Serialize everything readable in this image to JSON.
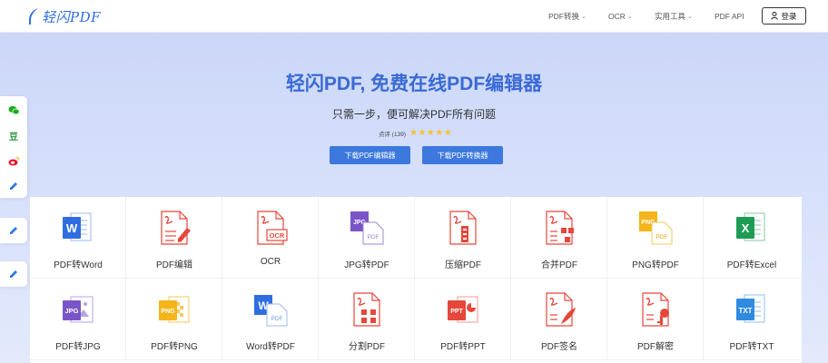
{
  "header": {
    "logo_text": "轻闪PDF",
    "nav": [
      {
        "label": "PDF转换",
        "dropdown": true
      },
      {
        "label": "OCR",
        "dropdown": true
      },
      {
        "label": "实用工具",
        "dropdown": true
      },
      {
        "label": "PDF API",
        "dropdown": false
      }
    ],
    "login_label": "登录"
  },
  "hero": {
    "title": "轻闪PDF, 免费在线PDF编辑器",
    "subtitle": "只需一步，便可解决PDF所有问题",
    "rating_text": "点评 (139)",
    "stars": 5,
    "buttons": [
      "下载PDF编辑器",
      "下载PDF转换器"
    ]
  },
  "sidebar": {
    "icons": [
      "wechat-icon",
      "douban-icon",
      "weibo-icon",
      "edit-icon",
      "edit-icon",
      "edit-icon"
    ]
  },
  "tools": [
    {
      "label": "PDF转Word",
      "icon": "word-icon",
      "color": "#2f6ee0"
    },
    {
      "label": "PDF编辑",
      "icon": "pdf-edit-icon",
      "color": "#e5473b"
    },
    {
      "label": "OCR",
      "icon": "ocr-icon",
      "color": "#e5473b"
    },
    {
      "label": "JPG转PDF",
      "icon": "jpg-to-pdf-icon",
      "color": "#7a55c8"
    },
    {
      "label": "压缩PDF",
      "icon": "compress-pdf-icon",
      "color": "#e5473b"
    },
    {
      "label": "合并PDF",
      "icon": "merge-pdf-icon",
      "color": "#e5473b"
    },
    {
      "label": "PNG转PDF",
      "icon": "png-to-pdf-icon",
      "color": "#f4b41a"
    },
    {
      "label": "PDF转Excel",
      "icon": "excel-icon",
      "color": "#1e9c55"
    },
    {
      "label": "PDF转JPG",
      "icon": "jpg-icon",
      "color": "#7a55c8"
    },
    {
      "label": "PDF转PNG",
      "icon": "png-icon",
      "color": "#f4b41a"
    },
    {
      "label": "Word转PDF",
      "icon": "word-to-pdf-icon",
      "color": "#2f6ee0"
    },
    {
      "label": "分割PDF",
      "icon": "split-pdf-icon",
      "color": "#e5473b"
    },
    {
      "label": "PDF转PPT",
      "icon": "ppt-icon",
      "color": "#e5473b"
    },
    {
      "label": "PDF签名",
      "icon": "sign-pdf-icon",
      "color": "#e5473b"
    },
    {
      "label": "PDF解密",
      "icon": "decrypt-pdf-icon",
      "color": "#e5473b"
    },
    {
      "label": "PDF转TXT",
      "icon": "txt-icon",
      "color": "#2f8be0"
    }
  ]
}
